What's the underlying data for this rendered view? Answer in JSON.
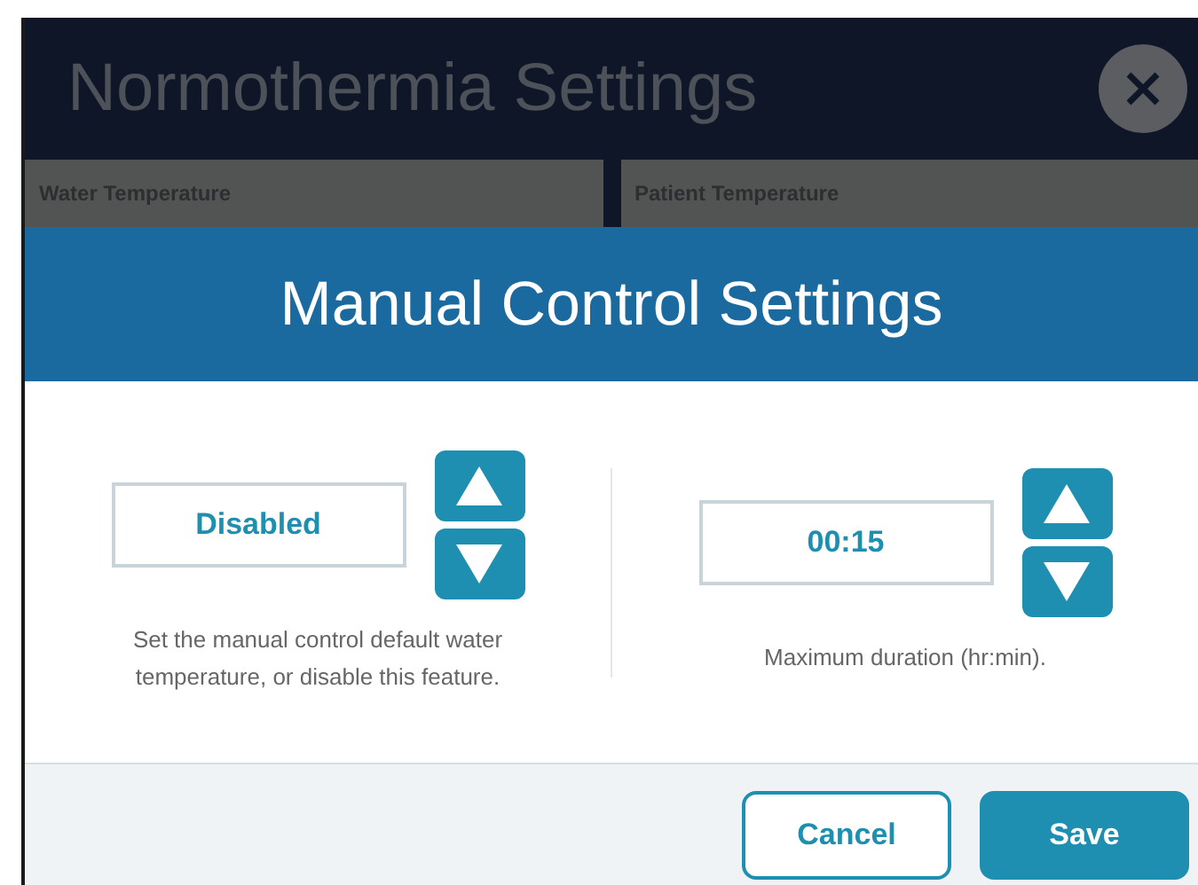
{
  "window": {
    "title": "Normothermia Settings"
  },
  "tabs": [
    {
      "label": "Water Temperature"
    },
    {
      "label": "Patient Temperature"
    }
  ],
  "dialog": {
    "title": "Manual Control Settings",
    "settings": [
      {
        "value": "Disabled",
        "caption": "Set the manual control default water temperature, or disable this feature."
      },
      {
        "value": "00:15",
        "caption": "Maximum duration (hr:min)."
      }
    ],
    "buttons": [
      {
        "label": "Cancel",
        "kind": "secondary"
      },
      {
        "label": "Save",
        "kind": "primary"
      }
    ]
  }
}
